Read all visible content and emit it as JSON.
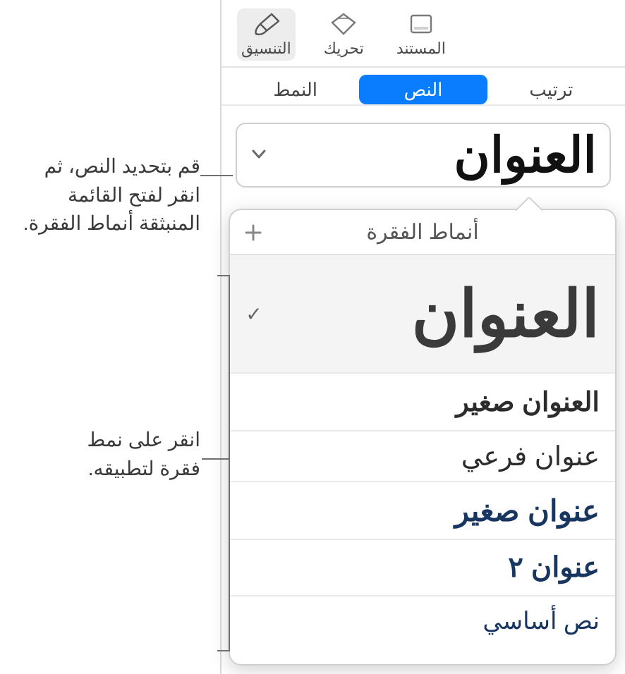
{
  "toolbar": {
    "format": "التنسيق",
    "animate": "تحريك",
    "document": "المستند"
  },
  "tabs": {
    "style": "النمط",
    "text": "النص",
    "arrange": "ترتيب"
  },
  "style_button": {
    "current": "العنوان"
  },
  "popover": {
    "title": "أنماط الفقرة",
    "items": [
      {
        "label": "العنوان",
        "selected": true
      },
      {
        "label": "العنوان صغير",
        "selected": false
      },
      {
        "label": "عنوان فرعي",
        "selected": false
      },
      {
        "label": "عنوان صغير",
        "selected": false
      },
      {
        "label": "عنوان ٢",
        "selected": false
      },
      {
        "label": "نص أساسي",
        "selected": false
      }
    ]
  },
  "callouts": {
    "c1": "قم بتحديد النص، ثم انقر لفتح القائمة المنبثقة أنماط الفقرة.",
    "c2": "انقر على نمط فقرة لتطبيقه."
  }
}
